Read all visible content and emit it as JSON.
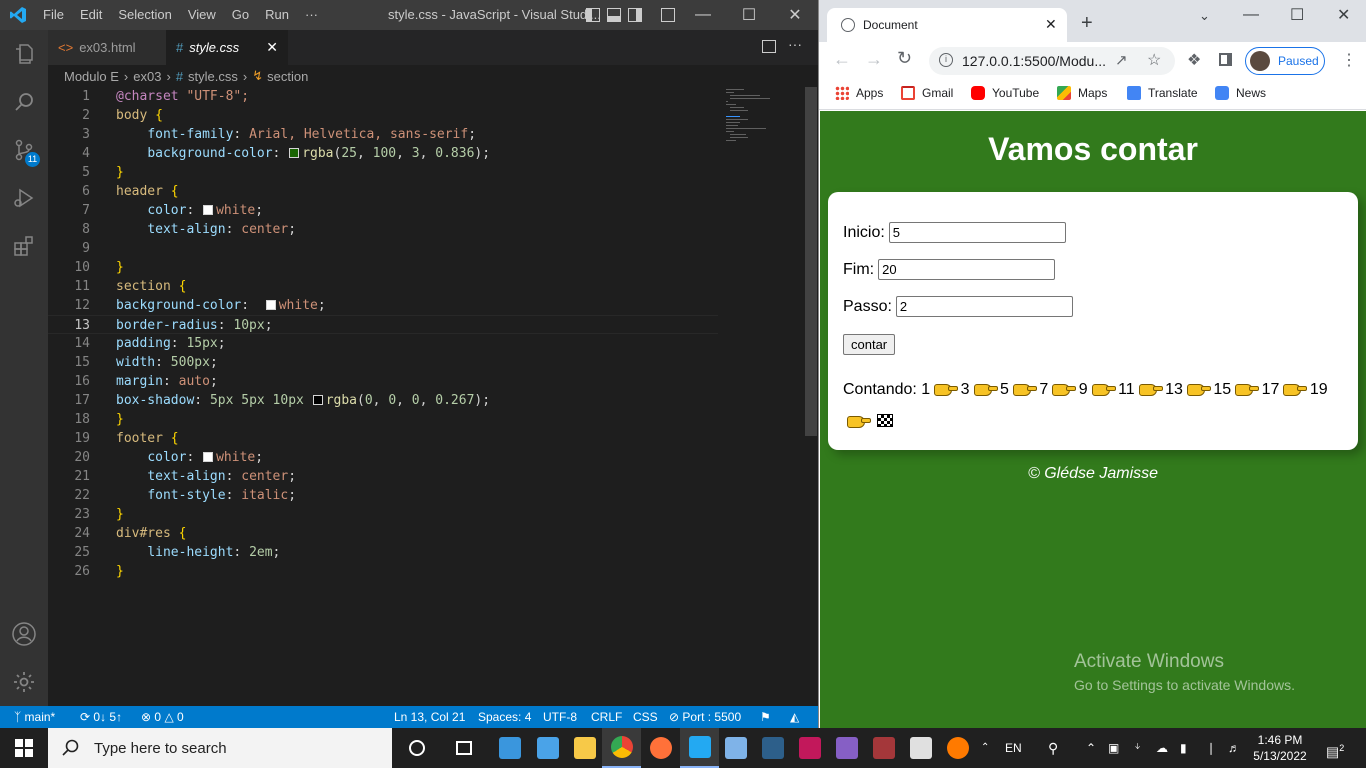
{
  "vscode": {
    "menu": [
      "File",
      "Edit",
      "Selection",
      "View",
      "Go",
      "Run",
      "···"
    ],
    "title": "style.css - JavaScript - Visual Studi...",
    "tabs": [
      {
        "icon": "<>",
        "label": "ex03.html"
      },
      {
        "icon": "#",
        "label": "style.css",
        "close": "✕"
      }
    ],
    "breadcrumb": [
      "Modulo E",
      "ex03",
      "style.css",
      "section"
    ],
    "activity_badge": "11",
    "lines": [
      {
        "n": "1"
      },
      {
        "n": "2"
      },
      {
        "n": "3"
      },
      {
        "n": "4"
      },
      {
        "n": "5"
      },
      {
        "n": "6"
      },
      {
        "n": "7"
      },
      {
        "n": "8"
      },
      {
        "n": "9"
      },
      {
        "n": "10"
      },
      {
        "n": "11"
      },
      {
        "n": "12"
      },
      {
        "n": "13"
      },
      {
        "n": "14"
      },
      {
        "n": "15"
      },
      {
        "n": "16"
      },
      {
        "n": "17"
      },
      {
        "n": "18"
      },
      {
        "n": "19"
      },
      {
        "n": "20"
      },
      {
        "n": "21"
      },
      {
        "n": "22"
      },
      {
        "n": "23"
      },
      {
        "n": "24"
      },
      {
        "n": "25"
      },
      {
        "n": "26"
      }
    ],
    "code": {
      "l1": {
        "at": "@charset",
        "val": "\"UTF-8\";"
      },
      "l2": {
        "sel": "body",
        "brace": "{"
      },
      "l3": {
        "prop": "font-family",
        "val": "Arial, Helvetica, sans-serif"
      },
      "l4": {
        "prop": "background-color",
        "fn": "rgba",
        "nums": [
          "25",
          "100",
          "3",
          "0.836"
        ],
        "swatch": "#196403"
      },
      "l5": "}",
      "l6": {
        "sel": "header",
        "brace": "{"
      },
      "l7": {
        "prop": "color",
        "val": "white",
        "swatch": "#ffffff"
      },
      "l8": {
        "prop": "text-align",
        "val": "center"
      },
      "l10": "}",
      "l11": {
        "sel": "section",
        "brace": "{"
      },
      "l12": {
        "prop": "background-color",
        "val": "white",
        "swatch": "#ffffff"
      },
      "l13": {
        "prop": "border-radius",
        "val": "10px"
      },
      "l14": {
        "prop": "padding",
        "val": "15px"
      },
      "l15": {
        "prop": "width",
        "val": "500px"
      },
      "l16": {
        "prop": "margin",
        "val": "auto"
      },
      "l17": {
        "prop": "box-shadow",
        "val": "5px 5px 10px",
        "fn": "rgba",
        "nums": [
          "0",
          "0",
          "0",
          "0.267"
        ],
        "swatch": "#000000"
      },
      "l18": "}",
      "l19": {
        "sel": "footer",
        "brace": "{"
      },
      "l20": {
        "prop": "color",
        "val": "white",
        "swatch": "#ffffff"
      },
      "l21": {
        "prop": "text-align",
        "val": "center"
      },
      "l22": {
        "prop": "font-style",
        "val": "italic"
      },
      "l23": "}",
      "l24": {
        "sel": "div#res",
        "brace": "{"
      },
      "l25": {
        "prop": "line-height",
        "val": "2em"
      },
      "l26": "}"
    },
    "status": {
      "branch": "main*",
      "sync": "0↓ 5↑",
      "problems": "0",
      "warnings": "0",
      "position": "Ln 13, Col 21",
      "spaces": "Spaces: 4",
      "encoding": "UTF-8",
      "eol": "CRLF",
      "language": "CSS",
      "port": "Port : 5500"
    }
  },
  "chrome": {
    "tab_title": "Document",
    "url": "127.0.0.1:5500/Modu...",
    "profile": "Paused",
    "bookmarks": [
      "Apps",
      "Gmail",
      "YouTube",
      "Maps",
      "Translate",
      "News"
    ]
  },
  "page": {
    "title": "Vamos contar",
    "fields": [
      {
        "label": "Inicio:",
        "value": "5"
      },
      {
        "label": "Fim:",
        "value": "20"
      },
      {
        "label": "Passo:",
        "value": "2"
      }
    ],
    "button": "contar",
    "result_label": "Contando:",
    "counts": [
      "1",
      "3",
      "5",
      "7",
      "9",
      "11",
      "13",
      "15",
      "17",
      "19"
    ],
    "footer": "© Glédse Jamisse",
    "activate_title": "Activate Windows",
    "activate_sub": "Go to Settings to activate Windows."
  },
  "taskbar": {
    "search_placeholder": "Type here to search",
    "language": "EN",
    "time": "1:46 PM",
    "date": "5/13/2022",
    "notifications": "2"
  }
}
